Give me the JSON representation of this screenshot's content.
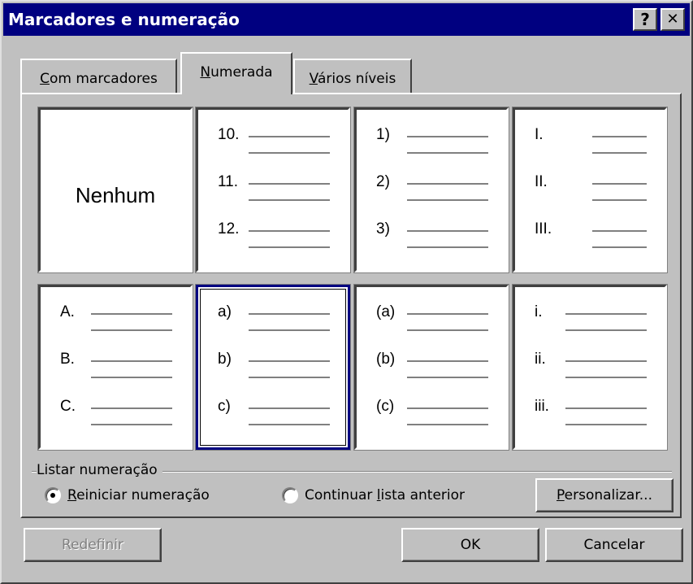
{
  "window": {
    "title": "Marcadores e numeração",
    "help_label": "?",
    "close_label": "✕"
  },
  "tabs": [
    {
      "label": "Com marcadores",
      "active": false
    },
    {
      "label": "Numerada",
      "active": true
    },
    {
      "label": "Vários níveis",
      "active": false
    }
  ],
  "gallery": {
    "none_label": "Nenhum",
    "styles": [
      [
        "10.",
        "11.",
        "12."
      ],
      [
        "1)",
        "2)",
        "3)"
      ],
      [
        "I.",
        "II.",
        "III."
      ],
      [
        "A.",
        "B.",
        "C."
      ],
      [
        "a)",
        "b)",
        "c)"
      ],
      [
        "(a)",
        "(b)",
        "(c)"
      ],
      [
        "i.",
        "ii.",
        "iii."
      ]
    ],
    "selected_style": "a)"
  },
  "list_numbering": {
    "section_label": "Listar numeração",
    "restart_label": "Reiniciar numeração",
    "continue_label": "Continuar lista anterior",
    "selected": "Reiniciar numeração"
  },
  "buttons": {
    "customize": "Personalizar...",
    "reset": "Redefinir",
    "ok": "OK",
    "cancel": "Cancelar"
  }
}
